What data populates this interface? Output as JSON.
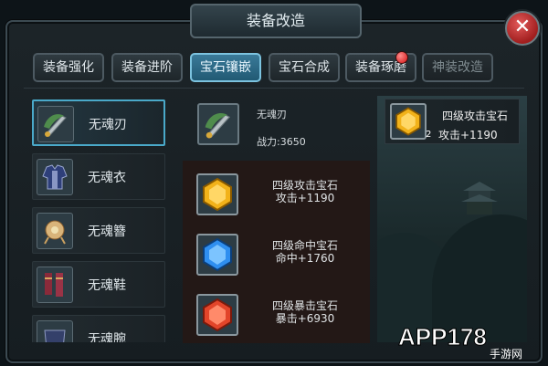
{
  "window": {
    "title": "装备改造",
    "close_glyph": "✕"
  },
  "tabs": [
    {
      "label": "装备强化",
      "state": "normal"
    },
    {
      "label": "装备进阶",
      "state": "normal"
    },
    {
      "label": "宝石镶嵌",
      "state": "active"
    },
    {
      "label": "宝石合成",
      "state": "normal"
    },
    {
      "label": "装备琢磨",
      "state": "normal",
      "badge": "red-dot"
    },
    {
      "label": "神装改造",
      "state": "disabled"
    }
  ],
  "equipment_list": [
    {
      "name": "无魂刃",
      "icon": "sword-icon",
      "selected": true
    },
    {
      "name": "无魂衣",
      "icon": "armor-icon",
      "selected": false
    },
    {
      "name": "无魂簪",
      "icon": "hairpin-icon",
      "selected": false
    },
    {
      "name": "无魂鞋",
      "icon": "boots-icon",
      "selected": false
    },
    {
      "name": "无魂腕",
      "icon": "bracer-icon",
      "selected": false
    }
  ],
  "selected_equipment": {
    "name": "无魂刃",
    "power": "战力:3650",
    "icon": "sword-icon"
  },
  "gem_slots": [
    {
      "name": "四级攻击宝石",
      "stat": "攻击+1190",
      "color": "#f2b21a",
      "icon": "yellow-gem-icon"
    },
    {
      "name": "四级命中宝石",
      "stat": "命中+1760",
      "color": "#2f8ff0",
      "icon": "blue-gem-icon"
    },
    {
      "name": "四级暴击宝石",
      "stat": "暴击+6930",
      "color": "#e2452a",
      "icon": "red-gem-icon"
    }
  ],
  "inventory_gem": {
    "name": "四级攻击宝石",
    "stat": "攻击+1190",
    "count": "2",
    "color": "#f2b21a",
    "icon": "yellow-gem-icon"
  },
  "watermark": {
    "text": "APP178",
    "sub": "手游网"
  },
  "colors": {
    "accent": "#4aa9c9",
    "close": "#c0282b",
    "badge": "#e01b1b"
  }
}
